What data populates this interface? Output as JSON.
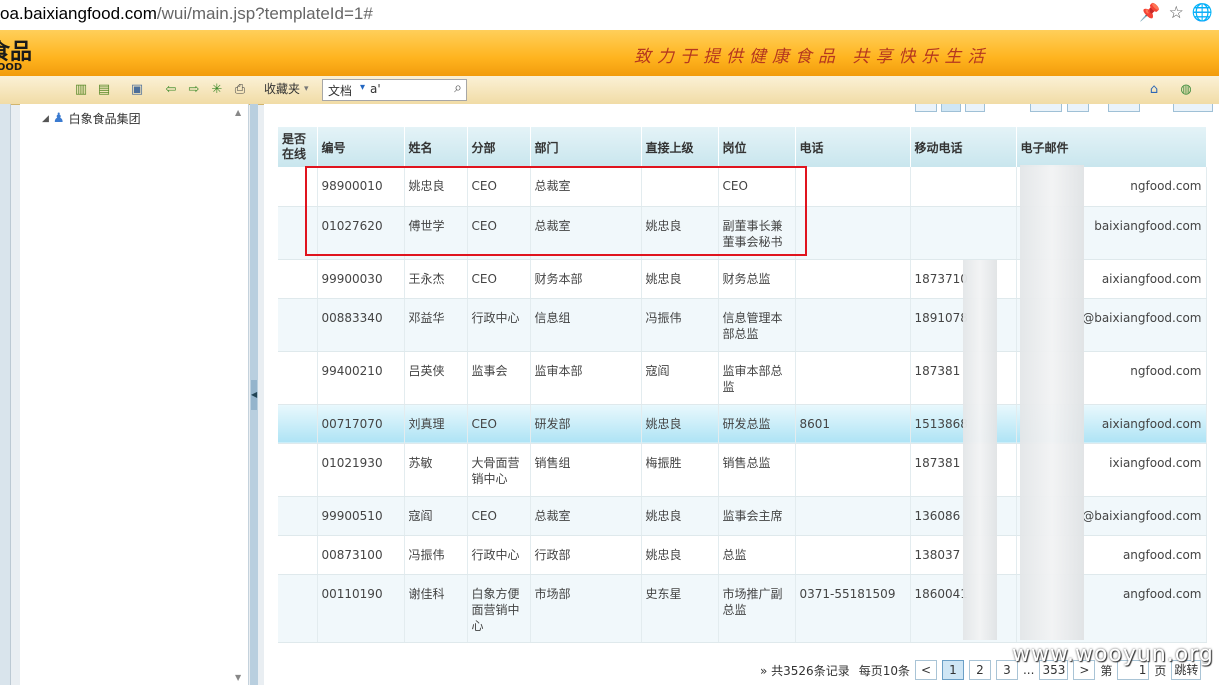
{
  "browser": {
    "url_host": "oa.baixiangfood.com",
    "url_path": "/wui/main.jsp?templateId=1#"
  },
  "banner": {
    "logo_cn": "食品",
    "logo_en": "FOOD",
    "slogan": "致力于提供健康食品   共享快乐生活"
  },
  "toolbar": {
    "favorites_label": "收藏夹",
    "search_type": "文档",
    "search_value": "a'"
  },
  "tree": {
    "root_label": "白象食品集团"
  },
  "table": {
    "headers": [
      "是否在线",
      "编号",
      "姓名",
      "分部",
      "部门",
      "直接上级",
      "岗位",
      "电话",
      "移动电话",
      "电子邮件"
    ],
    "rows": [
      [
        "",
        "98900010",
        "姚忠良",
        "CEO",
        "总裁室",
        "",
        "CEO",
        "",
        "",
        "ngfood.com"
      ],
      [
        "",
        "01027620",
        "傅世学",
        "CEO",
        "总裁室",
        "姚忠良",
        "副董事长兼董事会秘书",
        "",
        "",
        "baixiangfood.com"
      ],
      [
        "",
        "99900030",
        "王永杰",
        "CEO",
        "财务本部",
        "姚忠良",
        "财务总监",
        "",
        "1873710",
        "aixiangfood.com"
      ],
      [
        "",
        "00883340",
        "邓益华",
        "行政中心",
        "信息组",
        "冯振伟",
        "信息管理本部总监",
        "",
        "1891078",
        "@baixiangfood.com"
      ],
      [
        "",
        "99400210",
        "吕英侠",
        "监事会",
        "监审本部",
        "寇阎",
        "监审本部总监",
        "",
        "187381",
        "ngfood.com"
      ],
      [
        "",
        "00717070",
        "刘真理",
        "CEO",
        "研发部",
        "姚忠良",
        "研发总监",
        "8601",
        "1513868",
        "aixiangfood.com"
      ],
      [
        "",
        "01021930",
        "苏敏",
        "大骨面营销中心",
        "销售组",
        "梅振胜",
        "销售总监",
        "",
        "187381",
        "ixiangfood.com"
      ],
      [
        "",
        "99900510",
        "寇阎",
        "CEO",
        "总裁室",
        "姚忠良",
        "监事会主席",
        "",
        "136086",
        "@baixiangfood.com"
      ],
      [
        "",
        "00873100",
        "冯振伟",
        "行政中心",
        "行政部",
        "姚忠良",
        "总监",
        "",
        "138037",
        "angfood.com"
      ],
      [
        "",
        "00110190",
        "谢佳科",
        "白象方便面营销中心",
        "市场部",
        "史东星",
        "市场推广副总监",
        "0371-55181509",
        "1860041",
        "angfood.com"
      ]
    ]
  },
  "pager": {
    "total": "» 共3526条记录",
    "per_page": "每页10条",
    "prev": "<",
    "pages": [
      "1",
      "2",
      "3"
    ],
    "ellipsis": "...",
    "last": "353",
    "next": ">",
    "goto_prefix": "第",
    "goto_value": "1",
    "goto_suffix": "页",
    "jump": "跳转"
  },
  "watermark": "www.wooyun.org"
}
